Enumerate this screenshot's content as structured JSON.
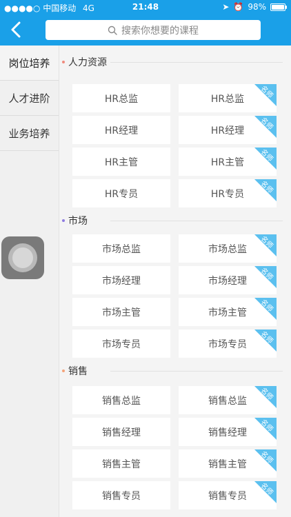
{
  "status_bar": {
    "signal": "●●●●○",
    "carrier": "中国移动",
    "network": "4G",
    "time": "21:48",
    "battery_percent": "98%"
  },
  "header": {
    "search_placeholder": "搜索你想要的课程"
  },
  "sidebar": {
    "items": [
      {
        "label": "岗位培养",
        "active": true
      },
      {
        "label": "人才进阶",
        "active": false
      },
      {
        "label": "业务培养",
        "active": false
      }
    ]
  },
  "badge_label": "名师",
  "sections": [
    {
      "title": "人力资源",
      "dot_color": "#f08a7c",
      "rows": [
        [
          "HR总监",
          "HR总监"
        ],
        [
          "HR经理",
          "HR经理"
        ],
        [
          "HR主管",
          "HR主管"
        ],
        [
          "HR专员",
          "HR专员"
        ]
      ]
    },
    {
      "title": "市场",
      "dot_color": "#8e7be0",
      "rows": [
        [
          "市场总监",
          "市场总监"
        ],
        [
          "市场经理",
          "市场经理"
        ],
        [
          "市场主管",
          "市场主管"
        ],
        [
          "市场专员",
          "市场专员"
        ]
      ]
    },
    {
      "title": "销售",
      "dot_color": "#f4a37a",
      "rows": [
        [
          "销售总监",
          "销售总监"
        ],
        [
          "销售经理",
          "销售经理"
        ],
        [
          "销售主管",
          "销售主管"
        ],
        [
          "销售专员",
          "销售专员"
        ]
      ]
    }
  ],
  "colors": {
    "accent": "#1aa0e8",
    "badge": "#5bc0ef"
  }
}
